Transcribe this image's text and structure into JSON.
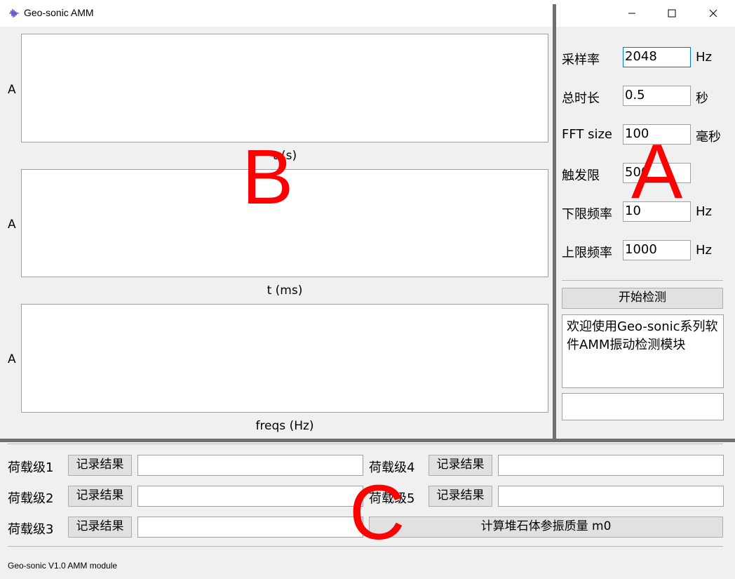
{
  "window": {
    "title": "Geo-sonic AMM"
  },
  "plots": [
    {
      "ylabel": "A",
      "xlabel": "t (s)"
    },
    {
      "ylabel": "A",
      "xlabel": "t (ms)"
    },
    {
      "ylabel": "A",
      "xlabel": "freqs (Hz)"
    }
  ],
  "settings": {
    "sample_rate": {
      "label": "采样率",
      "value": "2048",
      "unit": "Hz"
    },
    "duration": {
      "label": "总时长",
      "value": "0.5",
      "unit": "秒"
    },
    "fft_size": {
      "label": "FFT size",
      "value": "100",
      "unit": "毫秒"
    },
    "trigger": {
      "label": "触发限",
      "value": "500",
      "unit": ""
    },
    "low_freq": {
      "label": "下限频率",
      "value": "10",
      "unit": "Hz"
    },
    "high_freq": {
      "label": "上限频率",
      "value": "1000",
      "unit": "Hz"
    }
  },
  "start_button": "开始检测",
  "message": "欢迎使用Geo-sonic系列软件AMM振动检测模块",
  "loads": [
    {
      "label": "荷载级1",
      "button": "记录结果",
      "value": ""
    },
    {
      "label": "荷载级2",
      "button": "记录结果",
      "value": ""
    },
    {
      "label": "荷载级3",
      "button": "记录结果",
      "value": ""
    },
    {
      "label": "荷载级4",
      "button": "记录结果",
      "value": ""
    },
    {
      "label": "荷载级5",
      "button": "记录结果",
      "value": ""
    }
  ],
  "compute_button": "计算堆石体参振质量 m0",
  "status": "Geo-sonic V1.0 AMM module",
  "annotations": {
    "a": "A",
    "b": "B",
    "c": "C"
  }
}
